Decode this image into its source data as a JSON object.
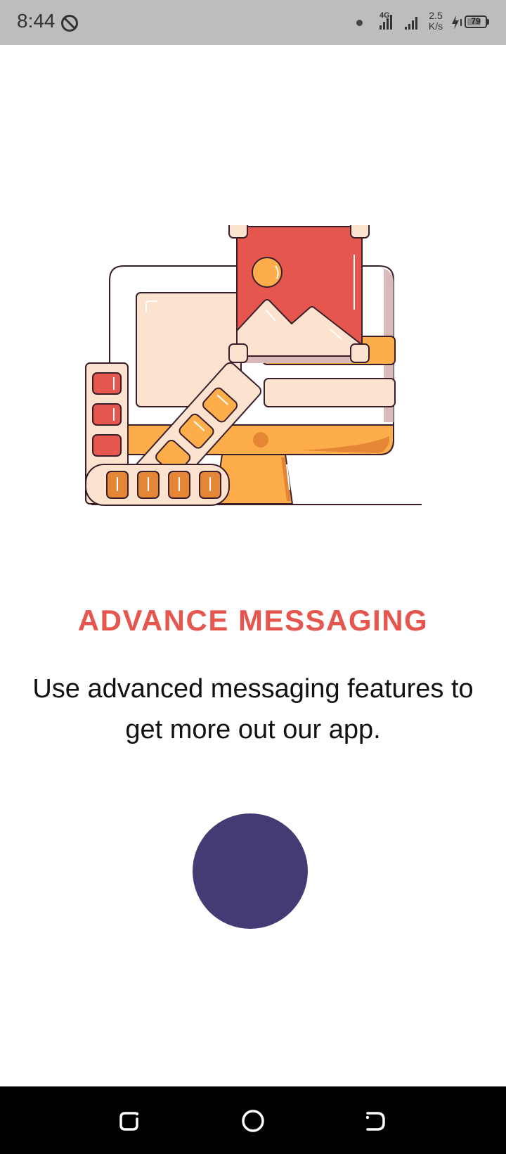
{
  "status_bar": {
    "time": "8:44",
    "network": "4G",
    "speed_value": "2.5",
    "speed_unit": "K/s",
    "battery": "79",
    "battery_level": 0.79
  },
  "onboarding": {
    "title": "ADVANCE MESSAGING",
    "description": "Use advanced messaging features to get more out our app.",
    "accent_color": "#e5564f",
    "button_color": "#453b74"
  },
  "icons": {
    "illustration": "computer-design-illustration",
    "recent": "recent-apps-icon",
    "home": "home-icon",
    "back": "back-icon"
  }
}
